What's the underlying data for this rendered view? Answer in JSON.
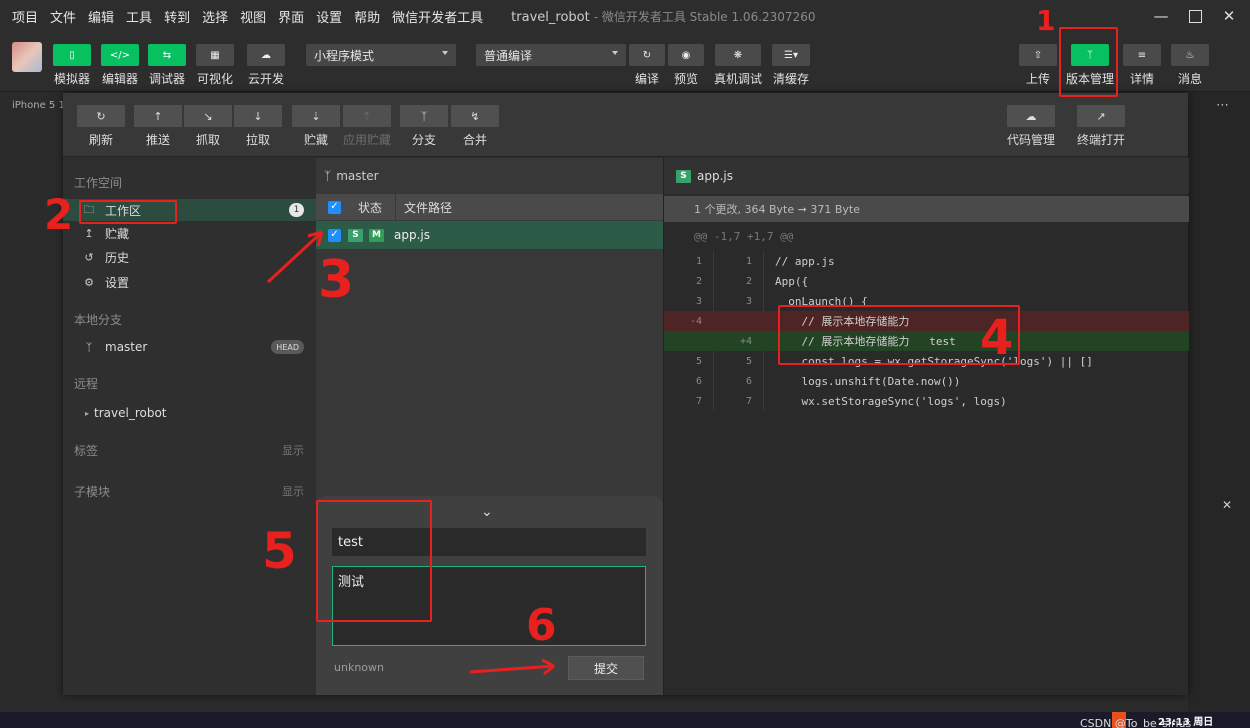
{
  "window": {
    "title": "travel_robot",
    "subtitle": "- 微信开发者工具 Stable 1.06.2307260"
  },
  "menu": [
    "项目",
    "文件",
    "编辑",
    "工具",
    "转到",
    "选择",
    "视图",
    "界面",
    "设置",
    "帮助",
    "微信开发者工具"
  ],
  "toolbar": {
    "left": [
      "模拟器",
      "编辑器",
      "调试器",
      "可视化",
      "云开发"
    ],
    "mode_select": "小程序模式",
    "compile_select": "普通编译",
    "mid": [
      "编译",
      "预览",
      "真机调试",
      "清缓存"
    ],
    "right": [
      "上传",
      "版本管理",
      "详情",
      "消息"
    ]
  },
  "device_label": "iPhone 5 1",
  "vc_toolbar": {
    "items": [
      "刷新",
      "推送",
      "抓取",
      "拉取",
      "贮藏",
      "应用贮藏",
      "分支",
      "合并"
    ],
    "right": [
      "代码管理",
      "终端打开"
    ]
  },
  "sidebar": {
    "workspace": "工作空间",
    "items": [
      "工作区",
      "贮藏",
      "历史",
      "设置"
    ],
    "workarea_badge": "1",
    "local_branch": "本地分支",
    "branch": "master",
    "head": "HEAD",
    "remote": "远程",
    "remote_repo": "travel_robot",
    "tags": "标签",
    "submodules": "子模块",
    "show": "显示"
  },
  "filelist": {
    "branch": "master",
    "col_status": "状态",
    "col_path": "文件路径",
    "file": {
      "tag1": "S",
      "tag2": "M",
      "name": "app.js"
    }
  },
  "commit": {
    "summary": "test",
    "description": "测试",
    "author": "unknown",
    "submit": "提交"
  },
  "diff": {
    "tag": "S",
    "file": "app.js",
    "summary": "1 个更改, 364 Byte ➞ 371 Byte",
    "hunk": "@@ -1,7 +1,7 @@",
    "lines": [
      {
        "old": "1",
        "new": "1",
        "code": "// app.js"
      },
      {
        "old": "2",
        "new": "2",
        "code": "App({"
      },
      {
        "old": "3",
        "new": "3",
        "code": "  onLaunch() {"
      },
      {
        "old": "-4",
        "new": "",
        "code": "    // 展示本地存储能力"
      },
      {
        "old": "",
        "new": "+4",
        "code": "    // 展示本地存储能力   test"
      },
      {
        "old": "5",
        "new": "5",
        "code": "    const logs = wx.getStorageSync('logs') || []"
      },
      {
        "old": "6",
        "new": "6",
        "code": "    logs.unshift(Date.now())"
      },
      {
        "old": "7",
        "new": "7",
        "code": "    wx.setStorageSync('logs', logs)"
      }
    ]
  },
  "annotations": [
    "1",
    "2",
    "3",
    "4",
    "5",
    "6"
  ],
  "taskbar": {
    "time": "23:13 周日",
    "watermark": "CSDN @To_be_sirius"
  },
  "colors": {
    "accent": "#07c160",
    "annotation": "#e8201e",
    "active_row": "#2c4c40"
  }
}
